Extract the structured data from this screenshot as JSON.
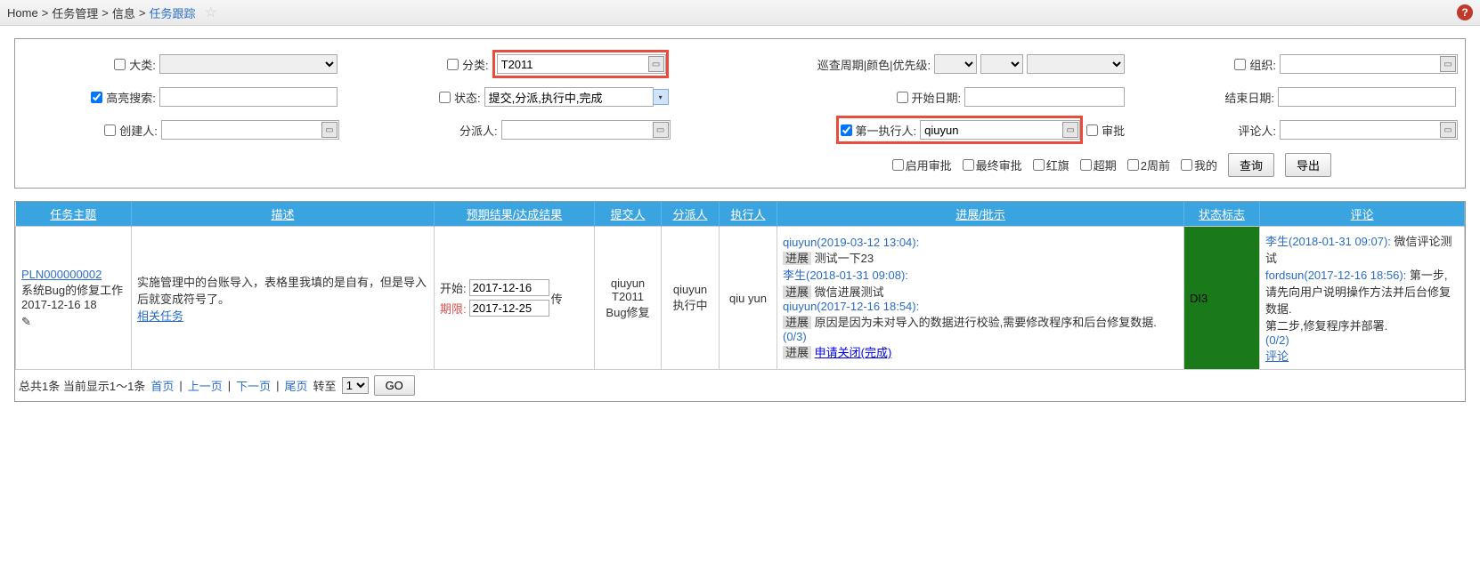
{
  "breadcrumb": {
    "home": "Home",
    "sep": ">",
    "l1": "任务管理",
    "l2": "信息",
    "current": "任务跟踪"
  },
  "filters": {
    "category_label": "大类:",
    "classify_label": "分类:",
    "classify_value": "T2011",
    "cycle_priority_label": "巡查周期|颜色|优先级:",
    "org_label": "组织:",
    "highlight_label": "高亮搜索:",
    "status_label": "状态:",
    "status_value": "提交,分派,执行中,完成",
    "start_date_label": "开始日期:",
    "end_date_label": "结束日期:",
    "creator_label": "创建人:",
    "assigner_label": "分派人:",
    "executor_label": "第一执行人:",
    "executor_value": "qiuyun",
    "approval_label": "审批",
    "reviewer_label": "评论人:",
    "enable_approval": "启用审批",
    "final_approval": "最终审批",
    "red_flag": "红旗",
    "overdue": "超期",
    "two_weeks": "2周前",
    "mine": "我的",
    "query_btn": "查询",
    "export_btn": "导出"
  },
  "table": {
    "headers": {
      "subject": "任务主题",
      "desc": "描述",
      "expected": "预期结果/达成结果",
      "submitter": "提交人",
      "assigner": "分派人",
      "executor": "执行人",
      "progress": "进展/批示",
      "status": "状态标志",
      "comments": "评论"
    },
    "row": {
      "task_id": "PLN000000002",
      "task_title": "系统Bug的修复工作",
      "task_date": "2017-12-16 18",
      "desc_text": "实施管理中的台账导入，表格里我填的是自有，但是导入后就变成符号了。",
      "related": "相关任务",
      "start_label": "开始:",
      "start_date": "2017-12-16",
      "deadline_label": "期限:",
      "deadline_date": "2017-12-25",
      "upload_suffix": "传",
      "submitter_line1": "qiuyun",
      "submitter_line2": "T2011",
      "submitter_line3": "Bug修复",
      "assigner_line1": "qiuyun",
      "assigner_line2": "执行中",
      "executor": "qiu yun",
      "prog1_user": "qiuyun(2019-03-12 13:04):",
      "prog1_tag": "进展",
      "prog1_text": "测试一下23",
      "prog2_user": "李生(2018-01-31 09:08):",
      "prog2_tag": "进展",
      "prog2_text": "微信进展测试",
      "prog3_user": "qiuyun(2017-12-16 18:54):",
      "prog3_tag": "进展",
      "prog3_text": "原因是因为未对导入的数据进行校验,需要修改程序和后台修复数据.",
      "prog_count": "(0/3)",
      "prog_close_tag": "进展",
      "prog_close": "申请关闭(完成)",
      "status_code": "DI3",
      "com1_user": "李生(2018-01-31 09:07):",
      "com1_text": "微信评论测试",
      "com2_user": "fordsun(2017-12-16 18:56):",
      "com2_text": "第一步,请先向用户说明操作方法并后台修复数据.",
      "com2_text2": "第二步,修复程序并部署.",
      "com_count": "(0/2)",
      "com_link": "评论"
    }
  },
  "pager": {
    "summary": "总共1条 当前显示1～1条",
    "first": "首页",
    "prev": "上一页",
    "next": "下一页",
    "last": "尾页",
    "goto_label": "转至",
    "page_value": "1",
    "go_btn": "GO"
  }
}
